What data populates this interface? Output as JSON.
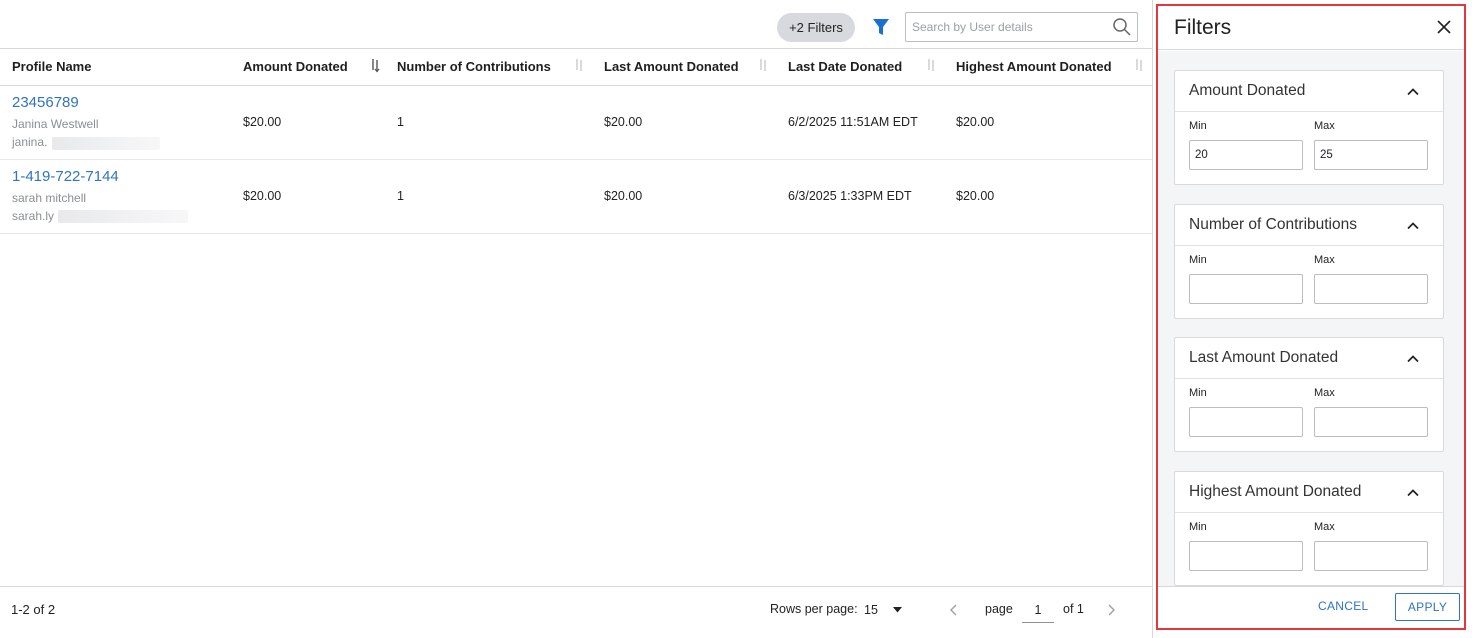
{
  "toolbar": {
    "filters_chip": "+2 Filters",
    "search_placeholder": "Search by User details"
  },
  "table": {
    "columns": [
      "Profile Name",
      "Amount Donated",
      "Number of Contributions",
      "Last Amount Donated",
      "Last Date Donated",
      "Highest Amount Donated"
    ],
    "rows": [
      {
        "profile_id": "23456789",
        "name": "Janina Westwell",
        "email": "janina.",
        "amount_donated": "$20.00",
        "contributions": "1",
        "last_amount": "$20.00",
        "last_date": "6/2/2025 11:51AM EDT",
        "highest_amount": "$20.00"
      },
      {
        "profile_id": "1-419-722-7144",
        "name": "sarah mitchell",
        "email": "sarah.ly",
        "amount_donated": "$20.00",
        "contributions": "1",
        "last_amount": "$20.00",
        "last_date": "6/3/2025 1:33PM EDT",
        "highest_amount": "$20.00"
      }
    ]
  },
  "footer": {
    "count": "1-2 of 2",
    "rows_per_page_label": "Rows per page:",
    "rows_per_page_value": "15",
    "page_label": "page",
    "page_value": "1",
    "of_label": "of 1"
  },
  "filter_panel": {
    "title": "Filters",
    "sections": [
      {
        "title": "Amount Donated",
        "min_label": "Min",
        "max_label": "Max",
        "min_value": "20",
        "max_value": "25"
      },
      {
        "title": "Number of Contributions",
        "min_label": "Min",
        "max_label": "Max",
        "min_value": "",
        "max_value": ""
      },
      {
        "title": "Last Amount Donated",
        "min_label": "Min",
        "max_label": "Max",
        "min_value": "",
        "max_value": ""
      },
      {
        "title": "Highest Amount Donated",
        "min_label": "Min",
        "max_label": "Max",
        "min_value": "",
        "max_value": ""
      }
    ],
    "cancel_label": "CANCEL",
    "apply_label": "APPLY"
  },
  "colors": {
    "accent": "#2f74c0",
    "filter_icon": "#1a6fd1",
    "panel_highlight_border": "#e0383e",
    "chip_bg": "#d7d9de"
  },
  "icons": {
    "filter": "funnel-icon",
    "search": "magnifier-icon",
    "sort": "sort-arrows-icon",
    "close": "close-icon",
    "collapse": "chevron-up-icon",
    "prev": "chevron-left-icon",
    "next": "chevron-right-icon",
    "dropdown": "caret-down-icon"
  }
}
